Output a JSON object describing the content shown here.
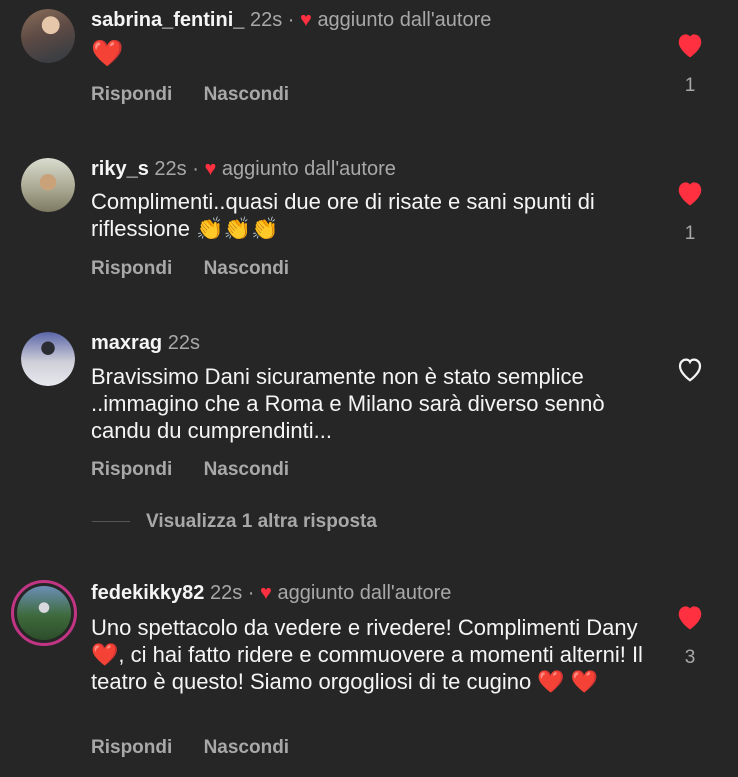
{
  "comments": [
    {
      "username": "sabrina_fentini_",
      "time": "22s",
      "separator": "·",
      "author_label": "aggiunto dall'autore",
      "text": "❤️",
      "reply_label": "Rispondi",
      "hide_label": "Nascondi",
      "liked": true,
      "likes": "1"
    },
    {
      "username": "riky_s",
      "time": "22s",
      "separator": "·",
      "author_label": "aggiunto dall'autore",
      "text": "Complimenti..quasi due ore di risate e sani spunti di riflessione 👏👏👏",
      "reply_label": "Rispondi",
      "hide_label": "Nascondi",
      "liked": true,
      "likes": "1"
    },
    {
      "username": "maxrag",
      "time": "22s",
      "text": "Bravissimo Dani sicuramente non è stato semplice ..immagino che a Roma e Milano sarà diverso sennò candu du cumprendinti...",
      "reply_label": "Rispondi",
      "hide_label": "Nascondi",
      "liked": false,
      "view_more": "Visualizza 1 altra risposta"
    },
    {
      "username": "fedekikky82",
      "time": "22s",
      "separator": "·",
      "author_label": "aggiunto dall'autore",
      "text": "Uno spettacolo da vedere e rivedere! Complimenti Dany❤️, ci hai fatto ridere e commuovere a momenti alterni! Il teatro è questo! Siamo orgogliosi di te cugino ❤️ ❤️",
      "reply_label": "Rispondi",
      "hide_label": "Nascondi",
      "liked": true,
      "likes": "3"
    }
  ],
  "colors": {
    "background": "#262626",
    "heart": "#ff3040",
    "muted": "#a8a8a8",
    "story_ring": "#c13584"
  }
}
